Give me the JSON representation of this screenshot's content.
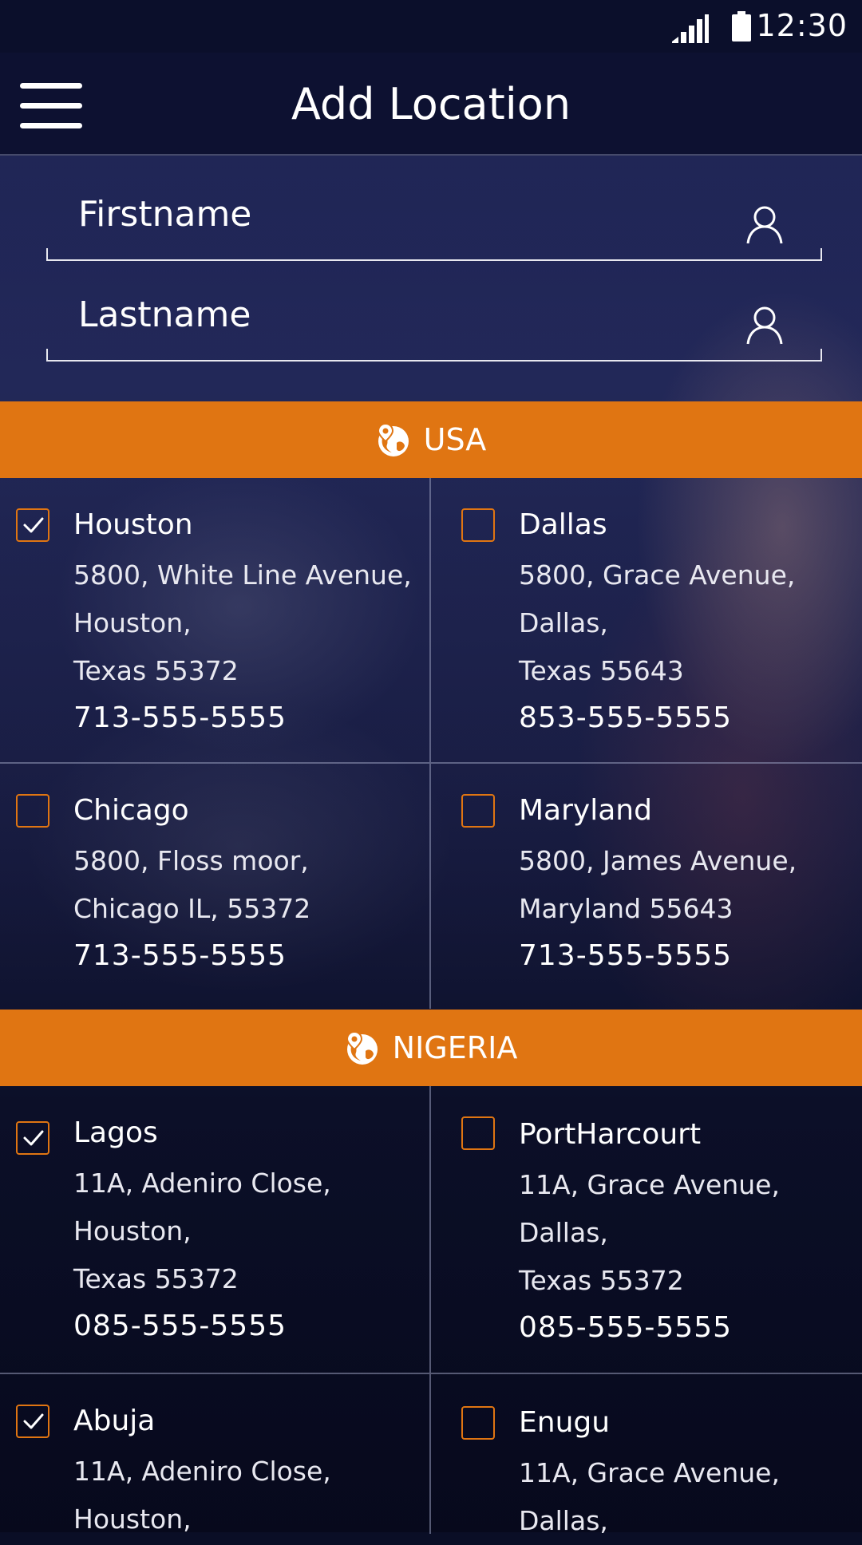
{
  "status_bar": {
    "time": "12:30"
  },
  "app_bar": {
    "title": "Add Location"
  },
  "form": {
    "firstname": {
      "value": "",
      "placeholder": "Firstname"
    },
    "lastname": {
      "value": "",
      "placeholder": "Lastname"
    }
  },
  "colors": {
    "accent": "#e07512",
    "appbar": "#0d1131"
  },
  "regions": [
    {
      "name": "USA",
      "locations": [
        {
          "city": "Houston",
          "address": [
            "5800, White Line Avenue,",
            "Houston,",
            "Texas 55372"
          ],
          "phone": "713-555-5555",
          "checked": true
        },
        {
          "city": "Dallas",
          "address": [
            "5800, Grace Avenue,",
            "Dallas,",
            "Texas 55643"
          ],
          "phone": "853-555-5555",
          "checked": false
        },
        {
          "city": "Chicago",
          "address": [
            "5800, Floss moor,",
            "Chicago IL, 55372"
          ],
          "phone": "713-555-5555",
          "checked": false
        },
        {
          "city": "Maryland",
          "address": [
            "5800, James Avenue,",
            "Maryland 55643"
          ],
          "phone": "713-555-5555",
          "checked": false
        }
      ]
    },
    {
      "name": "NIGERIA",
      "locations": [
        {
          "city": "Lagos",
          "address": [
            "11A, Adeniro Close,",
            "Houston,",
            "Texas 55372"
          ],
          "phone": "085-555-5555",
          "checked": true
        },
        {
          "city": "PortHarcourt",
          "address": [
            "11A, Grace Avenue,",
            "Dallas,",
            "Texas 55372"
          ],
          "phone": "085-555-5555",
          "checked": false
        },
        {
          "city": "Abuja",
          "address": [
            "11A, Adeniro Close,",
            "Houston,"
          ],
          "phone": "",
          "checked": true
        },
        {
          "city": "Enugu",
          "address": [
            "11A, Grace Avenue,",
            "Dallas,"
          ],
          "phone": "",
          "checked": false
        }
      ]
    }
  ]
}
